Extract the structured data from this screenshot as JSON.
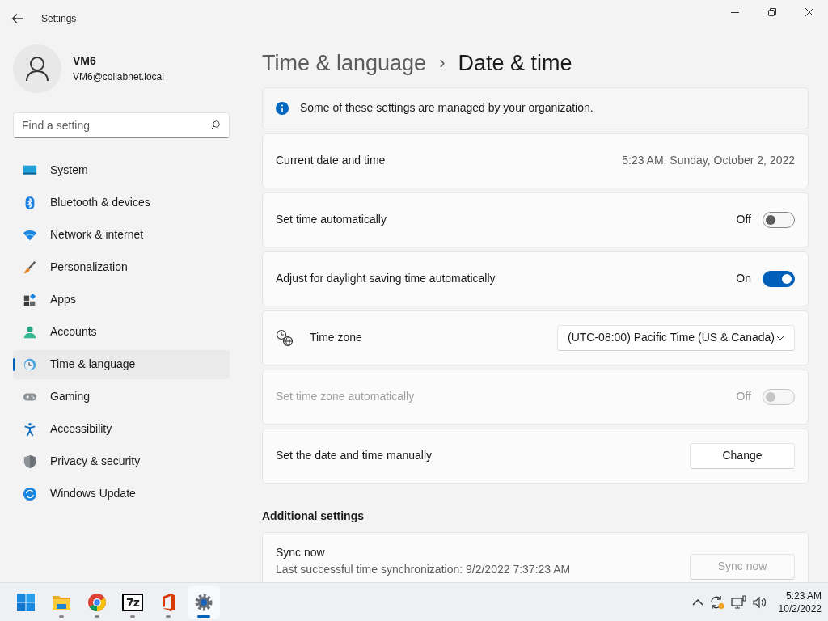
{
  "window": {
    "title": "Settings"
  },
  "user": {
    "name": "VM6",
    "email": "VM6@collabnet.local"
  },
  "search": {
    "placeholder": "Find a setting"
  },
  "nav": [
    {
      "label": "System",
      "kind": "system",
      "selected": false
    },
    {
      "label": "Bluetooth & devices",
      "kind": "bluetooth",
      "selected": false
    },
    {
      "label": "Network & internet",
      "kind": "network",
      "selected": false
    },
    {
      "label": "Personalization",
      "kind": "brush",
      "selected": false
    },
    {
      "label": "Apps",
      "kind": "apps",
      "selected": false
    },
    {
      "label": "Accounts",
      "kind": "accounts",
      "selected": false
    },
    {
      "label": "Time & language",
      "kind": "time",
      "selected": true
    },
    {
      "label": "Gaming",
      "kind": "gaming",
      "selected": false
    },
    {
      "label": "Accessibility",
      "kind": "accessibility",
      "selected": false
    },
    {
      "label": "Privacy & security",
      "kind": "shield",
      "selected": false
    },
    {
      "label": "Windows Update",
      "kind": "update",
      "selected": false
    }
  ],
  "breadcrumb": {
    "parent": "Time & language",
    "separator": "›",
    "current": "Date & time"
  },
  "notice": {
    "text": "Some of these settings are managed by your organization."
  },
  "rows": [
    {
      "kind": "value",
      "label": "Current date and time",
      "value": "5:23 AM, Sunday, October 2, 2022"
    },
    {
      "kind": "toggle",
      "label": "Set time automatically",
      "state_text": "Off",
      "on": false,
      "disabled": false
    },
    {
      "kind": "toggle",
      "label": "Adjust for daylight saving time automatically",
      "state_text": "On",
      "on": true,
      "disabled": false
    },
    {
      "kind": "dropdown",
      "label": "Time zone",
      "value": "(UTC-08:00) Pacific Time (US & Canada)"
    },
    {
      "kind": "toggle",
      "label": "Set time zone automatically",
      "state_text": "Off",
      "on": false,
      "disabled": true
    },
    {
      "kind": "button",
      "label": "Set the date and time manually",
      "button": "Change",
      "disabled": false
    }
  ],
  "additional": {
    "heading": "Additional settings",
    "sync": {
      "title": "Sync now",
      "lines": [
        "Last successful time synchronization: 9/2/2022 7:37:23 AM"
      ],
      "button": "Sync now",
      "disabled": true
    }
  },
  "taskbar": {
    "apps": [
      {
        "kind": "start",
        "running": false,
        "selected": false
      },
      {
        "kind": "folder",
        "running": true,
        "selected": false
      },
      {
        "kind": "chrome",
        "running": true,
        "selected": false
      },
      {
        "kind": "sevenzip",
        "text": "7z",
        "running": true,
        "selected": false
      },
      {
        "kind": "office",
        "running": true,
        "selected": false
      },
      {
        "kind": "settings",
        "running": true,
        "selected": true
      }
    ],
    "time": "5:23 AM",
    "date": "10/2/2022"
  }
}
